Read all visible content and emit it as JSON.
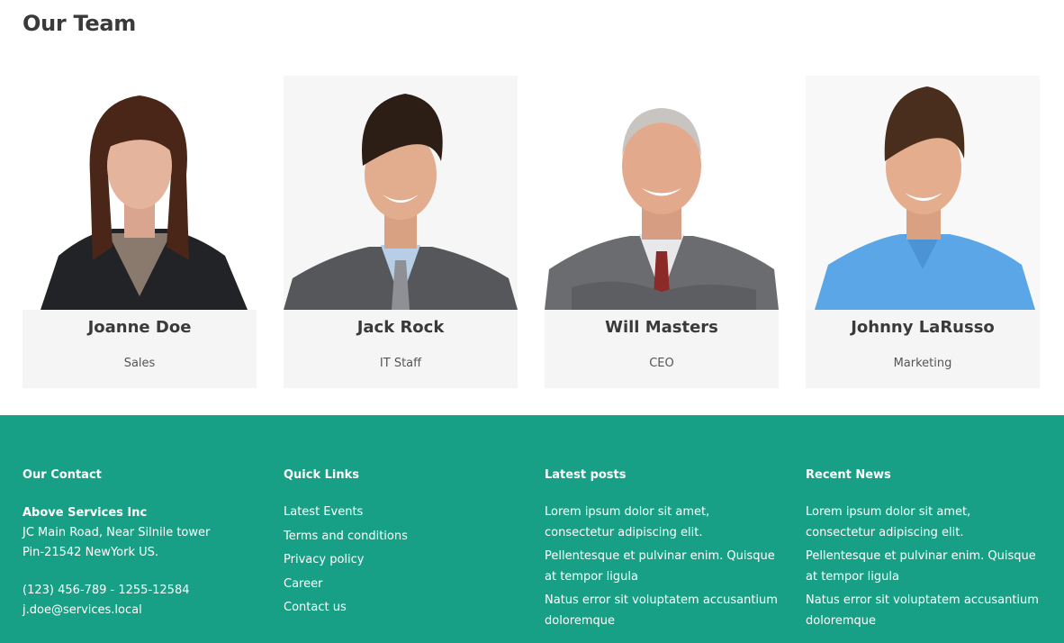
{
  "team": {
    "title": "Our Team",
    "members": [
      {
        "name": "Joanne Doe",
        "role": "Sales"
      },
      {
        "name": "Jack Rock",
        "role": "IT Staff"
      },
      {
        "name": "Will Masters",
        "role": "CEO"
      },
      {
        "name": "Johnny LaRusso",
        "role": "Marketing"
      }
    ]
  },
  "footer": {
    "contact": {
      "heading": "Our Contact",
      "company": "Above Services Inc",
      "address1": "JC Main Road, Near Silnile tower",
      "address2": "Pin-21542 NewYork US.",
      "phone": "(123) 456-789 - 1255-12584",
      "email": "j.doe@services.local"
    },
    "quick_links": {
      "heading": "Quick Links",
      "items": [
        "Latest Events",
        "Terms and conditions",
        "Privacy policy",
        "Career",
        "Contact us"
      ]
    },
    "latest_posts": {
      "heading": "Latest posts",
      "items": [
        "Lorem ipsum dolor sit amet, consectetur adipiscing elit.",
        "Pellentesque et pulvinar enim. Quisque at tempor ligula",
        "Natus error sit voluptatem accusantium doloremque"
      ]
    },
    "recent_news": {
      "heading": "Recent News",
      "items": [
        "Lorem ipsum dolor sit amet, consectetur adipiscing elit.",
        "Pellentesque et pulvinar enim. Quisque at tempor ligula",
        "Natus error sit voluptatem accusantium doloremque"
      ]
    }
  },
  "colors": {
    "footer_bg": "#17a085",
    "card_bg": "#f5f5f5",
    "heading_text": "#3a3a3a"
  }
}
